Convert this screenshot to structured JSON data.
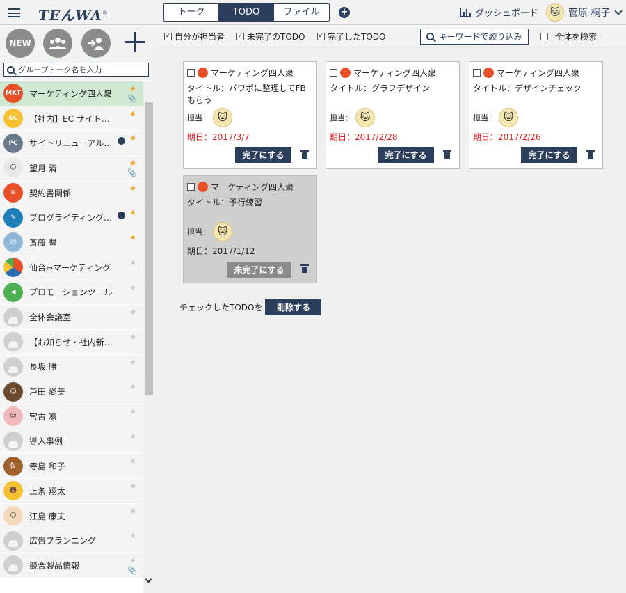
{
  "app": {
    "logo": "TEんWA",
    "logo_mark": "®"
  },
  "header": {
    "tabs": [
      {
        "label": "トーク"
      },
      {
        "label": "TODO"
      },
      {
        "label": "ファイル"
      }
    ],
    "dashboard_label": "ダッシュボード",
    "user_name": "菅原 桐子"
  },
  "sidebar": {
    "new_label": "NEW",
    "search_placeholder": "グループトーク名を入力",
    "groups": [
      {
        "name": "マーケティング四人衆",
        "star": true,
        "clip": true
      },
      {
        "name": "【社内】EC サイト更新",
        "star": true
      },
      {
        "name": "サイトリニューアル…",
        "star": true,
        "mute": true
      },
      {
        "name": "望月 清",
        "star": true,
        "clip": true
      },
      {
        "name": "契約書関係",
        "star": true
      },
      {
        "name": "ブログライティング…",
        "star": true,
        "mute": true
      },
      {
        "name": "斎藤 豊",
        "star": true
      },
      {
        "name": "仙台⇔マーケティング",
        "star": false
      },
      {
        "name": "プロモーションツール",
        "star": false
      },
      {
        "name": "全体会議室",
        "star": false
      },
      {
        "name": "【お知らせ・社内新…",
        "star": false
      },
      {
        "name": "長坂 勝",
        "star": false
      },
      {
        "name": "芦田 愛美",
        "star": false
      },
      {
        "name": "宮古 凛",
        "star": false
      },
      {
        "name": "導入事例",
        "star": false
      },
      {
        "name": "寺島 和子",
        "star": false
      },
      {
        "name": "上条 翔太",
        "star": false
      },
      {
        "name": "江島 康夫",
        "star": false
      },
      {
        "name": "広告プランニング",
        "star": false
      },
      {
        "name": "競合製品情報",
        "star": false,
        "clip": true
      }
    ]
  },
  "filters": {
    "mine": "自分が担当者",
    "incomplete": "未完了のTODO",
    "completed": "完了したTODO",
    "keyword_button": "キーワードで絞り込み",
    "search_all": "全体を検索"
  },
  "todos": [
    {
      "group": "マーケティング四人衆",
      "title": "タイトル：パワポに整理してFBもらう",
      "assignee_label": "担当：",
      "due": "期日：2017/3/7",
      "button": "完了にする",
      "done": false
    },
    {
      "group": "マーケティング四人衆",
      "title": "タイトル：グラフデザイン",
      "assignee_label": "担当：",
      "due": "期日：2017/2/28",
      "button": "完了にする",
      "done": false
    },
    {
      "group": "マーケティング四人衆",
      "title": "タイトル：デザインチェック",
      "assignee_label": "担当：",
      "due": "期日：2017/2/26",
      "button": "完了にする",
      "done": false
    },
    {
      "group": "マーケティング四人衆",
      "title": "タイトル：予行練習",
      "assignee_label": "担当：",
      "due": "期日：2017/1/12",
      "button": "未完了にする",
      "done": true
    }
  ],
  "bulk": {
    "label": "チェックしたTODOを",
    "delete_button": "削除する"
  },
  "colors": {
    "navy": "#2b3f5c",
    "active_group": "#cfe8d2",
    "due_red": "#e02020",
    "star": "#f0a020"
  }
}
